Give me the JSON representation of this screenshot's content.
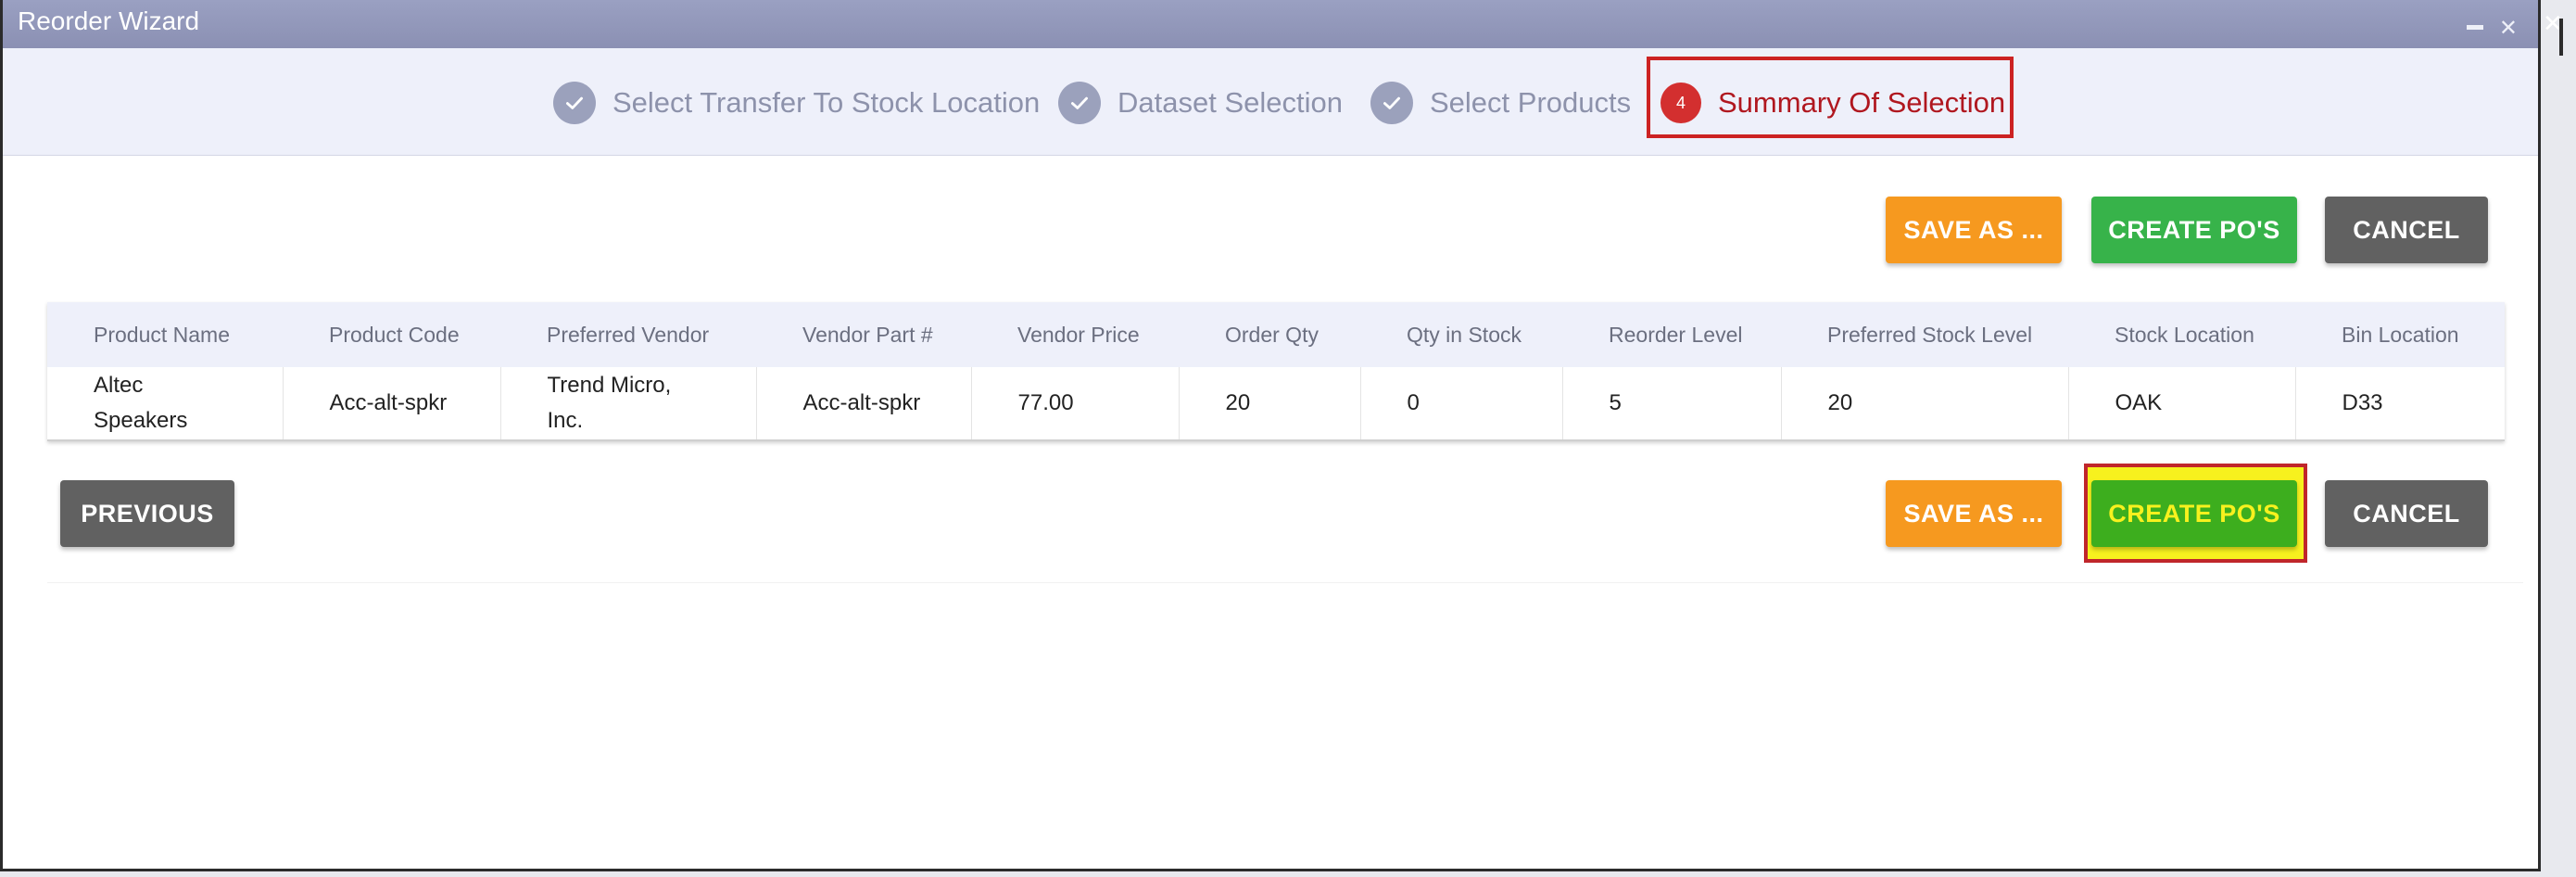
{
  "window": {
    "title": "Reorder Wizard"
  },
  "icons": {
    "minimize": "minimize-icon",
    "close": "close-icon",
    "step_done": "check-icon"
  },
  "colors": {
    "accent_active": "#b0171f",
    "save": "#f6991f",
    "create": "#37b34a",
    "cancel": "#616161",
    "highlight": "#f7f11e"
  },
  "stepper": {
    "steps": [
      {
        "label": "Select Transfer To Stock Location",
        "state": "done"
      },
      {
        "label": "Dataset Selection",
        "state": "done"
      },
      {
        "label": "Select Products",
        "state": "done"
      },
      {
        "label": "Summary Of Selection",
        "state": "active",
        "number": "4"
      }
    ]
  },
  "toolbar_top": {
    "save_as": "SAVE AS ...",
    "create_pos": "CREATE PO'S",
    "cancel": "CANCEL"
  },
  "table": {
    "columns": [
      "Product Name",
      "Product Code",
      "Preferred Vendor",
      "Vendor Part #",
      "Vendor Price",
      "Order Qty",
      "Qty in Stock",
      "Reorder Level",
      "Preferred Stock Level",
      "Stock Location",
      "Bin Location"
    ],
    "rows": [
      [
        "Altec Speakers",
        "Acc-alt-spkr",
        "Trend Micro, Inc.",
        "Acc-alt-spkr",
        "77.00",
        "20",
        "0",
        "5",
        "20",
        "OAK",
        "D33"
      ]
    ]
  },
  "toolbar_bottom": {
    "previous": "PREVIOUS",
    "save_as": "SAVE AS ...",
    "create_pos": "CREATE PO'S",
    "cancel": "CANCEL"
  }
}
